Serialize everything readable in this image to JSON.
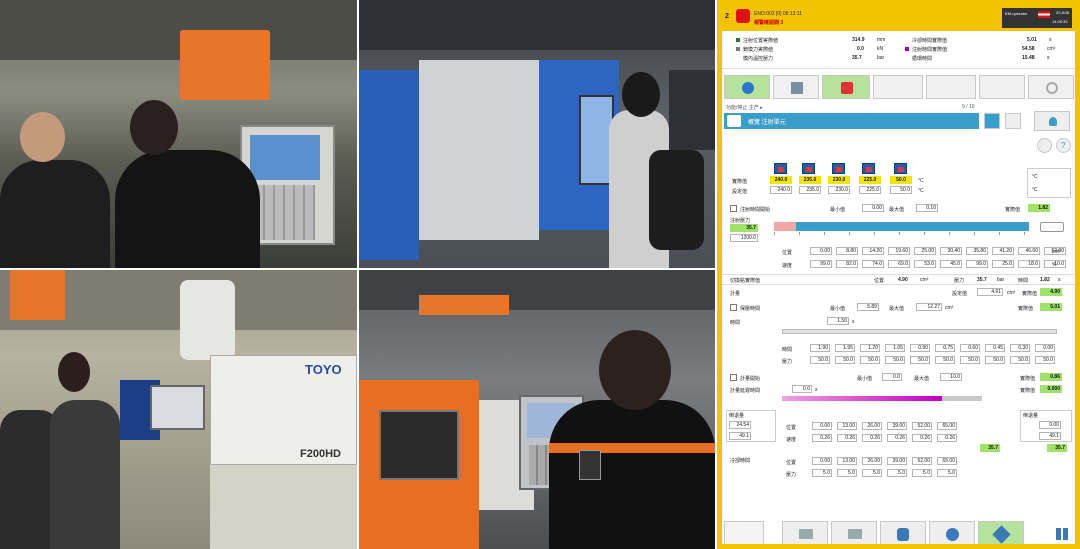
{
  "hmi": {
    "station": "2",
    "alarm_line1": "ENO:003 [0] 08:13:11",
    "alarm_line2": "報警確認閥 3",
    "user": "KM-operator",
    "date": "20-A08",
    "clock": "14:09:33",
    "summary": [
      {
        "label": "注射位置実際値",
        "value": "314.9",
        "unit": "mm"
      },
      {
        "label": "鎖模力実際値",
        "value": "0.0",
        "unit": "kN"
      },
      {
        "label": "模內溫控壓力",
        "value": "35.7",
        "unit": "bar"
      }
    ],
    "summary_right": [
      {
        "label": "冷卻時間實際值",
        "value": "5.01",
        "unit": "s"
      },
      {
        "label": "注射時間實際值",
        "value": "54.58",
        "unit": "cm³"
      },
      {
        "label": "循環時間",
        "value": "15.48",
        "unit": "s"
      }
    ],
    "breadcrumb": "功能/停止 主产 ▸",
    "page_indicator": "9 / 10",
    "section_title": "概覽 注射單元",
    "heaters": {
      "actual_label": "實際值",
      "set_label": "設定值",
      "actual": [
        "240.0",
        "235.0",
        "230.0",
        "225.0",
        "50.0"
      ],
      "set": [
        "240.0",
        "235.0",
        "230.0",
        "225.0",
        "50.0"
      ],
      "unit": "°C"
    },
    "injection": {
      "hold_label": "注射時間開始",
      "min_label": "最小值",
      "min": "0.00",
      "max_label": "最大值",
      "max": "0.10",
      "actual_label": "實際值",
      "actual": "1.82",
      "pressure_label": "注射壓力",
      "pressure": "35.7",
      "pressure_limit": "1200.0",
      "pos_label": "位置",
      "speed_label": "速度",
      "positions": [
        "0.00",
        "8.80",
        "14.20",
        "19.60",
        "25.00",
        "30.40",
        "35.80",
        "41.20",
        "46.60",
        "52.00"
      ],
      "speeds": [
        "99.0",
        "82.0",
        "74.0",
        "69.0",
        "53.0",
        "45.0",
        "99.0",
        "25.0",
        "18.0",
        "10.0"
      ]
    },
    "switch_row": {
      "label": "切換點實際值",
      "pos": "4.90",
      "pressure": "35.7",
      "time": "1.82"
    },
    "dose": {
      "label": "計量",
      "value": "4.91",
      "actual": "4.90"
    },
    "hold": {
      "label": "保壓時間",
      "min": "5.89",
      "max": "12.27",
      "actual": "5.01",
      "time_label": "時間",
      "pressure_label": "壓力",
      "time": "1.50",
      "times": [
        "1.90",
        "1.95",
        "1.20",
        "1.05",
        "0.90",
        "0.75",
        "0.60",
        "0.45",
        "0.30",
        "0.00"
      ],
      "pressures": [
        "50.0",
        "50.0",
        "50.0",
        "50.0",
        "50.0",
        "50.0",
        "50.0",
        "50.0",
        "50.0",
        "50.0"
      ]
    },
    "plast": {
      "label": "計量開始",
      "min": "0.0",
      "max": "10.0",
      "actual": "0.86",
      "speed_actual": "0.000",
      "recovery_label": "計量延遲時間",
      "recovery": "0.0"
    },
    "decomp": {
      "left_label": "倒退量",
      "left_val1": "24.54",
      "left_val2": "49.1",
      "pos_label": "位置",
      "speed_label": "速度",
      "positions": [
        "0.00",
        "13.00",
        "26.00",
        "39.00",
        "52.00",
        "65.00"
      ],
      "speeds": [
        "0.26",
        "0.26",
        "0.26",
        "0.26",
        "0.26",
        "0.26"
      ],
      "right_label": "倒退量",
      "right_val1": "0.00",
      "right_val2": "49.1",
      "actual": "35.7",
      "actual2": "35.7"
    },
    "cool": {
      "label": "冷卻時間",
      "positions": [
        "0.00",
        "13.00",
        "26.00",
        "39.00",
        "52.00",
        "65.00"
      ],
      "values": [
        "5.0",
        "5.0",
        "5.0",
        "5.0",
        "5.0",
        "5.0"
      ]
    },
    "colors": {
      "accent": "#f2c400",
      "green": "#9ee26a",
      "blue": "#3a9ecb",
      "title": "#3a9ecb"
    }
  }
}
